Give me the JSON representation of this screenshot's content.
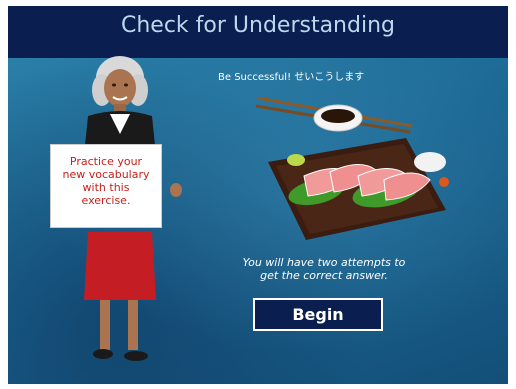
{
  "header": {
    "title": "Check for Understanding"
  },
  "slide": {
    "tagline": "Be Successful!  せいこうします",
    "sign_lines": [
      "Practice your",
      "new vocabulary",
      "with this",
      "exercise."
    ],
    "attempts_lines": [
      "You will have two attempts to",
      "get the correct answer."
    ],
    "begin_label": "Begin"
  },
  "colors": {
    "title_bar": "#0a1f4f",
    "title_text": "#bcd8ec",
    "background_blue": "#1b6793",
    "sign_text": "#c8201a",
    "button_bg": "#0a1f4f"
  },
  "icons": {
    "presenter": "woman-holding-sign-illustration",
    "food": "sushi-platter-illustration"
  }
}
